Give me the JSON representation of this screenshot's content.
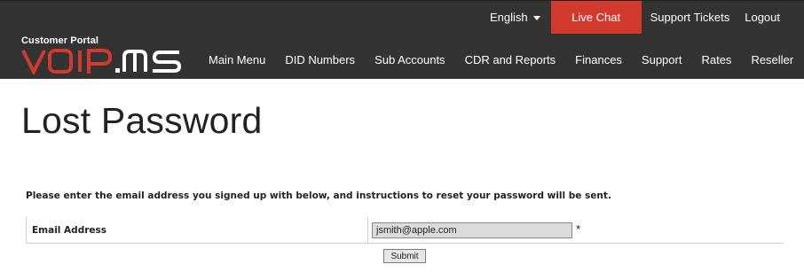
{
  "header": {
    "topbar": {
      "language": "English",
      "live_chat": "Live Chat",
      "support_tickets": "Support Tickets",
      "logout": "Logout"
    },
    "logo": {
      "subtitle": "Customer Portal",
      "brand": "VoIP.ms",
      "brand_color": "#d23a2e"
    },
    "nav": [
      {
        "label": "Main Menu"
      },
      {
        "label": "DID Numbers"
      },
      {
        "label": "Sub Accounts"
      },
      {
        "label": "CDR and Reports"
      },
      {
        "label": "Finances"
      },
      {
        "label": "Support"
      },
      {
        "label": "Rates"
      },
      {
        "label": "Reseller"
      }
    ]
  },
  "main": {
    "title": "Lost Password",
    "instructions": "Please enter the email address you signed up with below, and instructions to reset your password will be sent.",
    "form": {
      "email_label": "Email Address",
      "email_value": "jsmith@apple.com",
      "required_marker": "*",
      "submit_label": "Submit"
    }
  },
  "colors": {
    "header_bg": "#333333",
    "accent": "#d23a2e"
  }
}
